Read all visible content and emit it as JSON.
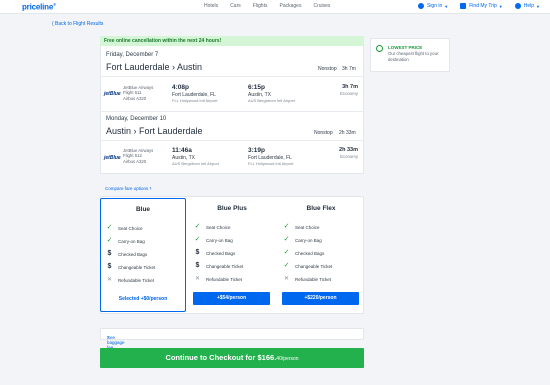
{
  "nav": {
    "logo": "priceline",
    "links": [
      "Hotels",
      "Cars",
      "Flights",
      "Packages",
      "Cruises"
    ],
    "sign_in": "Sign in",
    "find_my_trip": "Find My Trip",
    "help": "Help"
  },
  "back_link": "( Back to Flight Results",
  "banner": "Free online cancellation within the next 24 hours!",
  "outbound": {
    "date": "Friday, December 7",
    "route": "Fort Lauderdale › Austin",
    "stops": "Nonstop",
    "total_duration": "3h 7m",
    "airline_logo": "jetBlue",
    "airline": "JetBlue Airways",
    "flight": "Flight 511",
    "aircraft": "Airbus A320",
    "depart_time": "4:08p",
    "depart_city": "Fort Lauderdale, FL",
    "depart_airport": "FLL Hollywood Intl Airport",
    "arrive_time": "6:15p",
    "arrive_city": "Austin, TX",
    "arrive_airport": "AUS Bergstrom Intl Airport",
    "duration": "3h 7m",
    "cabin": "Economy"
  },
  "return": {
    "date": "Monday, December 10",
    "route": "Austin › Fort Lauderdale",
    "stops": "Nonstop",
    "total_duration": "2h 33m",
    "airline_logo": "jetBlue",
    "airline": "JetBlue Airways",
    "flight": "Flight 512",
    "aircraft": "Airbus A320",
    "depart_time": "11:46a",
    "depart_city": "Austin, TX",
    "depart_airport": "AUS Bergstrom Intl Airport",
    "arrive_time": "3:19p",
    "arrive_city": "Fort Lauderdale, FL",
    "arrive_airport": "FLL Hollywood Intl Airport",
    "duration": "2h 33m",
    "cabin": "Economy"
  },
  "lowest_price": {
    "title": "LOWEST PRICE",
    "text": "Our cheapest flight to your destination"
  },
  "compare_link": "Compare fare options",
  "fares": [
    {
      "name": "Blue",
      "features": [
        "Seat Choice",
        "Carry-on Bag",
        "Checked Bags",
        "Changeable Ticket",
        "Refundable Ticket"
      ],
      "action": "Selected +$0/person"
    },
    {
      "name": "Blue Plus",
      "features": [
        "Seat Choice",
        "Carry-on Bag",
        "Checked Bags",
        "Changeable Ticket",
        "Refundable Ticket"
      ],
      "action": "+$54/person"
    },
    {
      "name": "Blue Flex",
      "features": [
        "Seat Choice",
        "Carry-on Bag",
        "Checked Bags",
        "Changeable Ticket",
        "Refundable Ticket"
      ],
      "action": "+$220/person"
    }
  ],
  "baggage_link": "See baggage fee information",
  "checkout": {
    "label": "Continue to Checkout for $166.",
    "cents": "40/person"
  },
  "colors": {
    "brand_blue": "#0068ef",
    "checkout_green": "#22b14c",
    "banner_green": "#d4f5d6"
  }
}
